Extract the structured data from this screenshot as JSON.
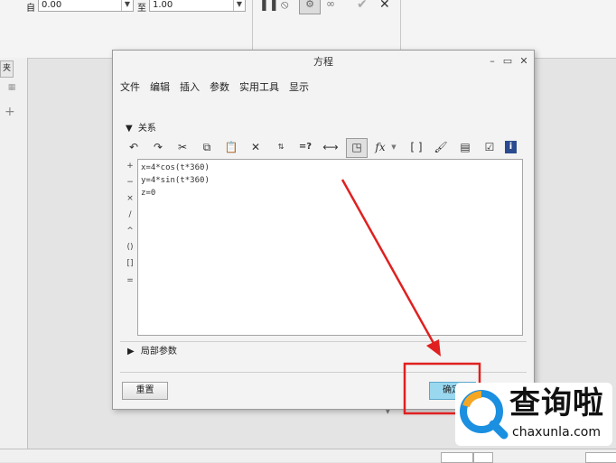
{
  "toolbar": {
    "label_from": "自",
    "from_value": "0.00",
    "label_to": "至",
    "to_value": "1.00"
  },
  "left_panel": {
    "tab_label": "夹"
  },
  "dialog": {
    "title": "方程",
    "menu": [
      "文件",
      "编辑",
      "插入",
      "参数",
      "实用工具",
      "显示"
    ],
    "section_relations": "关系",
    "operators": [
      "+",
      "−",
      "×",
      "/",
      "^",
      "()",
      "[]",
      "="
    ],
    "code_lines": [
      "x=4*cos(t*360)",
      "y=4*sin(t*360)",
      "z=0"
    ],
    "section_local_params": "局部参数",
    "reset_label": "重置",
    "ok_label": "确定"
  },
  "watermark": {
    "title": "查询啦",
    "url": "chaxunla.com"
  },
  "colors": {
    "annotation_red": "#e02020",
    "ok_button_highlight": "#9ad8f0",
    "watermark_blue": "#1b8fe0",
    "watermark_orange": "#f5a623"
  }
}
